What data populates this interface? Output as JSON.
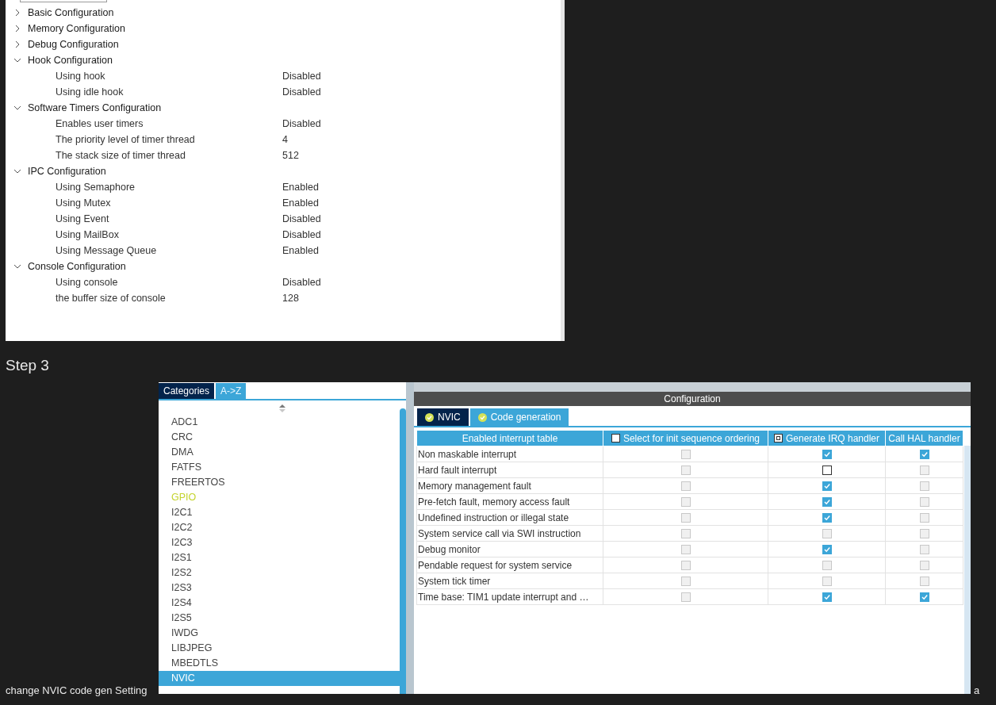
{
  "tree": [
    {
      "label": "Basic Configuration",
      "expanded": false
    },
    {
      "label": "Memory Configuration",
      "expanded": false
    },
    {
      "label": "Debug Configuration",
      "expanded": false
    },
    {
      "label": "Hook Configuration",
      "expanded": true,
      "children": [
        {
          "name": "Using hook",
          "value": "Disabled"
        },
        {
          "name": "Using idle hook",
          "value": "Disabled"
        }
      ]
    },
    {
      "label": "Software Timers Configuration",
      "expanded": true,
      "children": [
        {
          "name": "Enables user timers",
          "value": "Disabled"
        },
        {
          "name": "The priority level of timer thread",
          "value": "4"
        },
        {
          "name": "The stack size of timer thread",
          "value": "512"
        }
      ]
    },
    {
      "label": "IPC Configuration",
      "expanded": true,
      "children": [
        {
          "name": "Using Semaphore",
          "value": "Enabled"
        },
        {
          "name": "Using Mutex",
          "value": "Enabled"
        },
        {
          "name": "Using Event",
          "value": "Disabled"
        },
        {
          "name": "Using MailBox",
          "value": "Disabled"
        },
        {
          "name": "Using Message Queue",
          "value": "Enabled"
        }
      ]
    },
    {
      "label": "Console Configuration",
      "expanded": true,
      "children": [
        {
          "name": "Using console",
          "value": "Disabled"
        },
        {
          "name": "the buffer size of console",
          "value": "128"
        }
      ]
    }
  ],
  "step_heading": "Step 3",
  "left_tabs": [
    {
      "label": "Categories",
      "selected": false
    },
    {
      "label": "A->Z",
      "selected": true
    }
  ],
  "peripherals": [
    {
      "label": "ADC1",
      "selected": false,
      "kind": "normal"
    },
    {
      "label": "CRC",
      "selected": false,
      "kind": "normal"
    },
    {
      "label": "DMA",
      "selected": false,
      "kind": "normal"
    },
    {
      "label": "FATFS",
      "selected": false,
      "kind": "normal"
    },
    {
      "label": "FREERTOS",
      "selected": false,
      "kind": "normal"
    },
    {
      "label": "GPIO",
      "selected": false,
      "kind": "configured"
    },
    {
      "label": "I2C1",
      "selected": false,
      "kind": "normal"
    },
    {
      "label": "I2C2",
      "selected": false,
      "kind": "normal"
    },
    {
      "label": "I2C3",
      "selected": false,
      "kind": "normal"
    },
    {
      "label": "I2S1",
      "selected": false,
      "kind": "normal"
    },
    {
      "label": "I2S2",
      "selected": false,
      "kind": "normal"
    },
    {
      "label": "I2S3",
      "selected": false,
      "kind": "normal"
    },
    {
      "label": "I2S4",
      "selected": false,
      "kind": "normal"
    },
    {
      "label": "I2S5",
      "selected": false,
      "kind": "normal"
    },
    {
      "label": "IWDG",
      "selected": false,
      "kind": "normal"
    },
    {
      "label": "LIBJPEG",
      "selected": false,
      "kind": "normal"
    },
    {
      "label": "MBEDTLS",
      "selected": false,
      "kind": "normal"
    },
    {
      "label": "NVIC",
      "selected": true,
      "kind": "normal"
    }
  ],
  "config_title": "Configuration",
  "config_tabs": [
    {
      "label": "NVIC",
      "selected": false
    },
    {
      "label": "Code generation",
      "selected": true
    }
  ],
  "table": {
    "columns": [
      {
        "label": "Enabled interrupt table"
      },
      {
        "label": "Select for init sequence ordering",
        "checkbox": {
          "mixed": false
        }
      },
      {
        "label": "Generate IRQ handler",
        "checkbox": {
          "mixed": true
        }
      },
      {
        "label": "Call HAL handler"
      }
    ],
    "rows": [
      {
        "name": "Non maskable interrupt",
        "cells": [
          {
            "checked": false,
            "disabled": true
          },
          {
            "checked": true,
            "disabled": false
          },
          {
            "checked": true,
            "disabled": false
          }
        ]
      },
      {
        "name": "Hard fault interrupt",
        "cells": [
          {
            "checked": false,
            "disabled": true
          },
          {
            "checked": false,
            "disabled": false
          },
          {
            "checked": false,
            "disabled": true
          }
        ]
      },
      {
        "name": "Memory management fault",
        "cells": [
          {
            "checked": false,
            "disabled": true
          },
          {
            "checked": true,
            "disabled": false
          },
          {
            "checked": false,
            "disabled": true
          }
        ]
      },
      {
        "name": "Pre-fetch fault, memory access fault",
        "cells": [
          {
            "checked": false,
            "disabled": true
          },
          {
            "checked": true,
            "disabled": false
          },
          {
            "checked": false,
            "disabled": true
          }
        ]
      },
      {
        "name": "Undefined instruction or illegal state",
        "cells": [
          {
            "checked": false,
            "disabled": true
          },
          {
            "checked": true,
            "disabled": false
          },
          {
            "checked": false,
            "disabled": true
          }
        ]
      },
      {
        "name": "System service call via SWI instruction",
        "cells": [
          {
            "checked": false,
            "disabled": true
          },
          {
            "checked": false,
            "disabled": true
          },
          {
            "checked": false,
            "disabled": true
          }
        ]
      },
      {
        "name": "Debug monitor",
        "cells": [
          {
            "checked": false,
            "disabled": true
          },
          {
            "checked": true,
            "disabled": false
          },
          {
            "checked": false,
            "disabled": true
          }
        ]
      },
      {
        "name": "Pendable request for system service",
        "cells": [
          {
            "checked": false,
            "disabled": true
          },
          {
            "checked": false,
            "disabled": true
          },
          {
            "checked": false,
            "disabled": true
          }
        ]
      },
      {
        "name": "System tick timer",
        "cells": [
          {
            "checked": false,
            "disabled": true
          },
          {
            "checked": false,
            "disabled": true
          },
          {
            "checked": false,
            "disabled": true
          }
        ]
      },
      {
        "name": "Time base: TIM1 update interrupt and …",
        "cells": [
          {
            "checked": false,
            "disabled": true
          },
          {
            "checked": true,
            "disabled": false
          },
          {
            "checked": true,
            "disabled": false
          }
        ]
      }
    ]
  },
  "caption": "change NVIC code gen Setting",
  "trailing_text": "a"
}
